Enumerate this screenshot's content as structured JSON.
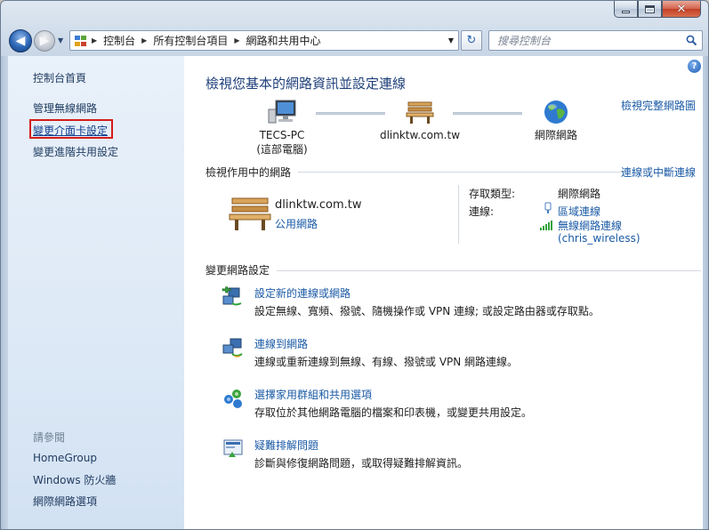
{
  "window": {
    "caption": {
      "minimize": "–",
      "close": "✕"
    }
  },
  "nav": {
    "back": "◀",
    "forward": "▶",
    "breadcrumbs": [
      "控制台",
      "所有控制台項目",
      "網路和共用中心"
    ],
    "search_placeholder": "搜尋控制台",
    "refresh_glyph": "↻"
  },
  "sidebar": {
    "items": [
      {
        "label": "控制台首頁"
      },
      {
        "label": "管理無線網路"
      },
      {
        "label": "變更介面卡設定"
      },
      {
        "label": "變更進階共用設定"
      }
    ],
    "see_also_title": "請參閱",
    "see_also": [
      "HomeGroup",
      "Windows 防火牆",
      "網際網路選項"
    ]
  },
  "main": {
    "title": "檢視您基本的網路資訊並設定連線",
    "full_map_link": "檢視完整網路圖",
    "map": {
      "computer": {
        "name": "TECS-PC",
        "sub": "(這部電腦)"
      },
      "network": {
        "name": "dlinktw.com.tw"
      },
      "internet": {
        "name": "網際網路"
      }
    },
    "active": {
      "heading": "檢視作用中的網路",
      "link": "連線或中斷連線",
      "name": "dlinktw.com.tw",
      "type": "公用網路",
      "access_label": "存取類型:",
      "access_value": "網際網路",
      "conn_label": "連線:",
      "conn_local": "區域連線",
      "conn_wireless": "無線網路連線",
      "conn_wireless_ssid": "(chris_wireless)"
    },
    "change": {
      "heading": "變更網路設定",
      "tasks": [
        {
          "link": "設定新的連線或網路",
          "desc": "設定無線、寬頻、撥號、隨機操作或 VPN 連線; 或設定路由器或存取點。"
        },
        {
          "link": "連線到網路",
          "desc": "連線或重新連線到無線、有線、撥號或 VPN 網路連線。"
        },
        {
          "link": "選擇家用群組和共用選項",
          "desc": "存取位於其他網路電腦的檔案和印表機，或變更共用設定。"
        },
        {
          "link": "疑難排解問題",
          "desc": "診斷與修復網路問題，或取得疑難排解資訊。"
        }
      ]
    },
    "help": "?"
  },
  "colors": {
    "link": "#1a5aa5",
    "title": "#1e3f79",
    "selection_box": "#d51b1b"
  }
}
